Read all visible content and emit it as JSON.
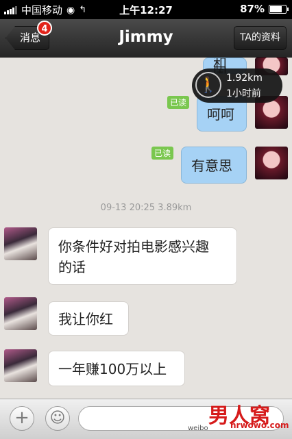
{
  "status_bar": {
    "carrier": "中国移动",
    "time": "上午12:27",
    "battery_percent": "87%",
    "battery_level": 0.87
  },
  "nav": {
    "back_label": "消息",
    "badge_count": "4",
    "title": "Jimmy",
    "profile_label": "TA的资料"
  },
  "location_popup": {
    "distance": "1.92km",
    "time_ago": "1小时前"
  },
  "messages": {
    "partial_top": "和国",
    "m1": "呵呵",
    "m1_read": "已读",
    "m2": "有意思",
    "m2_read": "已读",
    "timestamp": "09-13 20:25    3.89km",
    "m3_line1": "你条件好对拍电影感兴趣",
    "m3_line2": "的话",
    "m4": "我让你红",
    "m5": "一年赚100万以上"
  },
  "watermark": {
    "logo_text": "男人窝",
    "site_text": "nrwowo.com",
    "weibo_text": "weibo"
  },
  "colors": {
    "outgoing_bubble": "#a6d2f5",
    "incoming_bubble": "#ffffff",
    "read_badge": "#7ac74f",
    "unread_badge": "#e2231a"
  }
}
